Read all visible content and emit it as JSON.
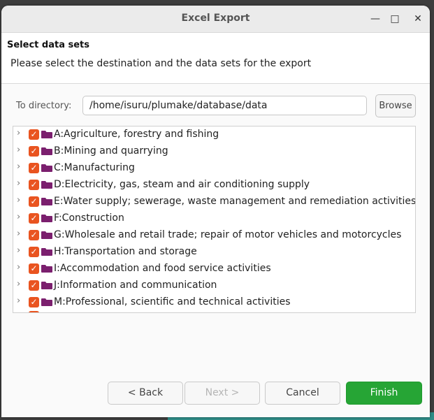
{
  "window": {
    "title": "Excel Export",
    "minimize_glyph": "—",
    "maximize_glyph": "□",
    "close_glyph": "✕"
  },
  "header": {
    "title": "Select data sets",
    "description": "Please select the destination and the data sets for the export"
  },
  "directory": {
    "label": "To directory:",
    "value": "/home/isuru/plumake/database/data",
    "browse_label": "Browse"
  },
  "tree": {
    "items": [
      {
        "label": "A:Agriculture, forestry and fishing",
        "checked": true
      },
      {
        "label": "B:Mining and quarrying",
        "checked": true
      },
      {
        "label": "C:Manufacturing",
        "checked": true
      },
      {
        "label": "D:Electricity, gas, steam and air conditioning supply",
        "checked": true
      },
      {
        "label": "E:Water supply; sewerage, waste management and remediation activities",
        "checked": true
      },
      {
        "label": "F:Construction",
        "checked": true
      },
      {
        "label": "G:Wholesale and retail trade; repair of motor vehicles and motorcycles",
        "checked": true
      },
      {
        "label": "H:Transportation and storage",
        "checked": true
      },
      {
        "label": "I:Accommodation and food service activities",
        "checked": true
      },
      {
        "label": "J:Information and communication",
        "checked": true
      },
      {
        "label": "M:Professional, scientific and technical activities",
        "checked": true
      }
    ]
  },
  "buttons": {
    "back": "< Back",
    "next": "Next >",
    "cancel": "Cancel",
    "finish": "Finish"
  },
  "colors": {
    "checkbox": "#e95420",
    "folder": "#7b1f6e",
    "finish": "#26a535"
  },
  "icons": {
    "expand": "chevron-right-icon",
    "folder": "folder-icon",
    "check": "checkmark-icon"
  }
}
